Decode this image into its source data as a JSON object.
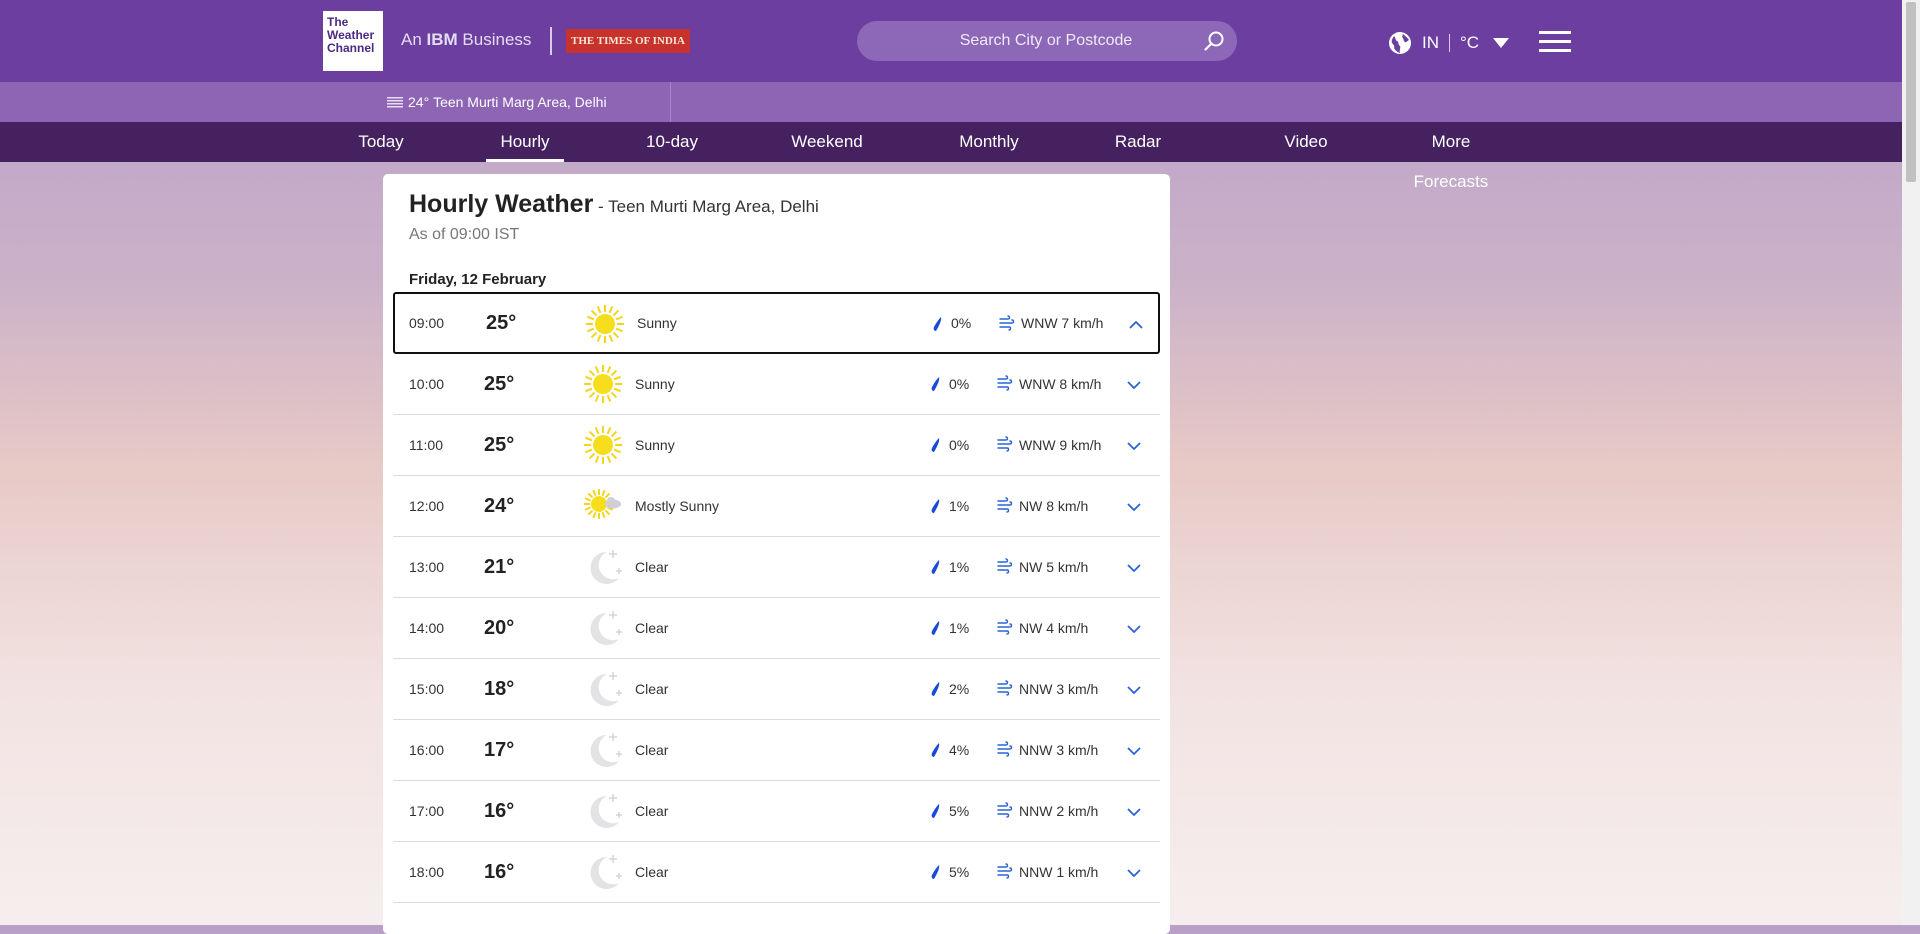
{
  "header": {
    "logo_lines": [
      "The",
      "Weather",
      "Channel"
    ],
    "ibm_prefix": "An ",
    "ibm_brand": "IBM",
    "ibm_suffix": " Business",
    "partner": "THE TIMES OF INDIA",
    "search_placeholder": "Search City or Postcode",
    "country": "IN",
    "unit": "°C",
    "brand_color": "#6b3ea0"
  },
  "location_bar": {
    "temp": "24°",
    "location": "Teen Murti Marg Area, Delhi",
    "icon": "fog-icon"
  },
  "nav": {
    "items": [
      "Today",
      "Hourly",
      "10-day",
      "Weekend",
      "Monthly",
      "Radar",
      "Video",
      "More Forecasts"
    ],
    "active": "Hourly"
  },
  "main": {
    "title": "Hourly Weather",
    "subtitle": " - Teen Murti Marg Area, Delhi",
    "as_of": "As of 09:00 IST",
    "date": "Friday, 12 February",
    "rows": [
      {
        "time": "09:00",
        "temp": "25°",
        "icon": "sun-icon",
        "cond": "Sunny",
        "precip": "0%",
        "wind": "WNW 7 km/h",
        "open": true
      },
      {
        "time": "10:00",
        "temp": "25°",
        "icon": "sun-icon",
        "cond": "Sunny",
        "precip": "0%",
        "wind": "WNW 8 km/h",
        "open": false
      },
      {
        "time": "11:00",
        "temp": "25°",
        "icon": "sun-icon",
        "cond": "Sunny",
        "precip": "0%",
        "wind": "WNW 9 km/h",
        "open": false
      },
      {
        "time": "12:00",
        "temp": "24°",
        "icon": "mostly-sunny-icon",
        "cond": "Mostly Sunny",
        "precip": "1%",
        "wind": "NW 8 km/h",
        "open": false
      },
      {
        "time": "13:00",
        "temp": "21°",
        "icon": "moon-icon",
        "cond": "Clear",
        "precip": "1%",
        "wind": "NW 5 km/h",
        "open": false
      },
      {
        "time": "14:00",
        "temp": "20°",
        "icon": "moon-icon",
        "cond": "Clear",
        "precip": "1%",
        "wind": "NW 4 km/h",
        "open": false
      },
      {
        "time": "15:00",
        "temp": "18°",
        "icon": "moon-icon",
        "cond": "Clear",
        "precip": "2%",
        "wind": "NNW 3 km/h",
        "open": false
      },
      {
        "time": "16:00",
        "temp": "17°",
        "icon": "moon-icon",
        "cond": "Clear",
        "precip": "4%",
        "wind": "NNW 3 km/h",
        "open": false
      },
      {
        "time": "17:00",
        "temp": "16°",
        "icon": "moon-icon",
        "cond": "Clear",
        "precip": "5%",
        "wind": "NNW 2 km/h",
        "open": false
      },
      {
        "time": "18:00",
        "temp": "16°",
        "icon": "moon-icon",
        "cond": "Clear",
        "precip": "5%",
        "wind": "NNW 1 km/h",
        "open": false
      }
    ]
  }
}
